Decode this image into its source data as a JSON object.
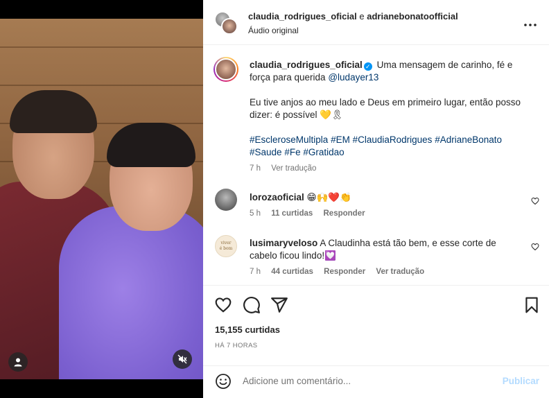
{
  "header": {
    "user1": "claudia_rodrigues_oficial",
    "separator": "e",
    "user2": "adrianebonatoofficial",
    "audio": "Áudio original",
    "more_icon": "more-horizontal-icon"
  },
  "caption": {
    "username": "claudia_rodrigues_oficial",
    "text_1": "Uma mensagem de carinho, fé e força para querida",
    "mention": "@ludayer13",
    "text_2": "Eu tive anjos ao meu lado e Deus em primeiro lugar, então posso dizer: é possível",
    "text_2_emoji": "💛🎗",
    "hashtags": [
      "#EscleroseMultipla",
      "#EM",
      "#ClaudiaRodrigues",
      "#AdrianeBonato",
      "#Saude",
      "#Fe",
      "#Gratidao"
    ],
    "time": "7 h",
    "translate": "Ver tradução"
  },
  "comments": [
    {
      "username": "lorozaoficial",
      "text": "😁🙌❤️👏",
      "time": "5 h",
      "likes": "11 curtidas",
      "reply": "Responder"
    },
    {
      "username": "lusimaryveloso",
      "text": "A Claudinha está tão bem, e esse corte de cabelo ficou lindo!💟",
      "time": "7 h",
      "likes": "44 curtidas",
      "reply": "Responder",
      "translate": "Ver tradução"
    }
  ],
  "actions": {
    "likes": "15,155 curtidas",
    "time": "HÁ 7 HORAS"
  },
  "add_comment": {
    "placeholder": "Adicione um comentário...",
    "publish": "Publicar"
  },
  "colors": {
    "link": "#00376b",
    "verified": "#0095f6",
    "publish_disabled": "#b3dbff",
    "secondary_text": "#737373"
  }
}
